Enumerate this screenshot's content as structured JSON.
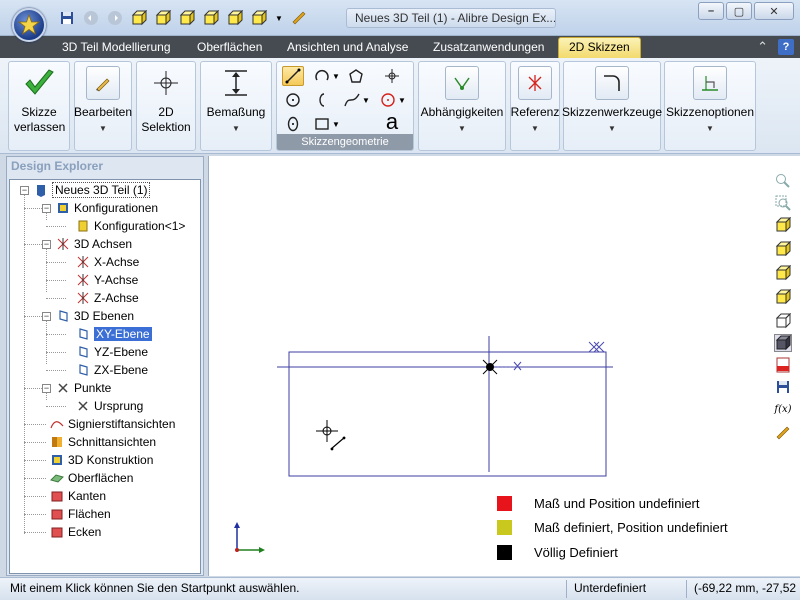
{
  "window": {
    "title": "Neues 3D Teil (1) - Alibre Design Ex...",
    "minimize": "–",
    "maximize": "▢",
    "close": "✕"
  },
  "tabs": [
    {
      "label": "3D Teil Modellierung"
    },
    {
      "label": "Oberflächen"
    },
    {
      "label": "Ansichten und Analyse"
    },
    {
      "label": "Zusatzanwendungen"
    },
    {
      "label": "2D Skizzen"
    }
  ],
  "ribbon": {
    "exit_sketch": "Skizze verlassen",
    "edit": "Bearbeiten",
    "selection_2d": "2D Selektion",
    "dimension": "Bemaßung",
    "sketch_geometry_caption": "Skizzengeometrie",
    "constraints": "Abhängigkeiten",
    "reference": "Referenz",
    "sketch_tools": "Skizzenwerkzeuge",
    "sketch_options": "Skizzenoptionen",
    "text_tool_glyph": "a"
  },
  "explorer": {
    "title": "Design Explorer",
    "items": [
      {
        "label": "Neues 3D Teil (1)"
      },
      {
        "label": "Konfigurationen"
      },
      {
        "label": "Konfiguration<1>"
      },
      {
        "label": "3D Achsen"
      },
      {
        "label": "X-Achse"
      },
      {
        "label": "Y-Achse"
      },
      {
        "label": "Z-Achse"
      },
      {
        "label": "3D Ebenen"
      },
      {
        "label": "XY-Ebene"
      },
      {
        "label": "YZ-Ebene"
      },
      {
        "label": "ZX-Ebene"
      },
      {
        "label": "Punkte"
      },
      {
        "label": "Ursprung"
      },
      {
        "label": "Signierstiftansichten"
      },
      {
        "label": "Schnittansichten"
      },
      {
        "label": "3D Konstruktion"
      },
      {
        "label": "Oberflächen"
      },
      {
        "label": "Kanten"
      },
      {
        "label": "Flächen"
      },
      {
        "label": "Ecken"
      }
    ]
  },
  "legend": [
    {
      "label": "Maß und Position undefiniert",
      "color": "#e8141c"
    },
    {
      "label": "Maß definiert, Position undefiniert",
      "color": "#c8c81e"
    },
    {
      "label": "Völlig Definiert",
      "color": "#000000"
    }
  ],
  "rightbar_fx": "f(x)",
  "status": {
    "hint": "Mit einem Klick können Sie den Startpunkt auswählen.",
    "state": "Unterdefiniert",
    "coords": "(-69,22 mm, -27,52 m"
  },
  "colors": {
    "sketch_line": "#3c3ca0",
    "selection": "#3b6fd6",
    "tab_active": "#f2d96a"
  }
}
